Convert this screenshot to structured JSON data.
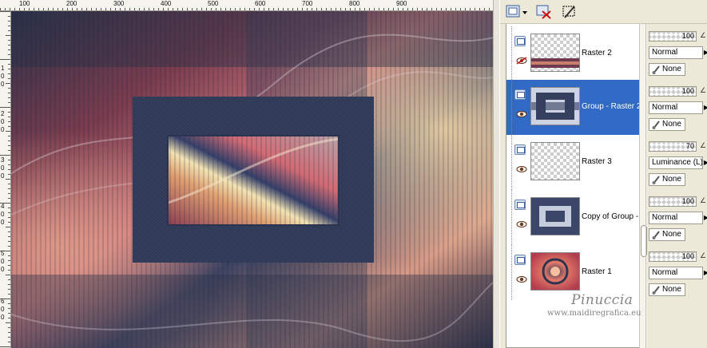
{
  "rulers": {
    "top_labels": [
      "100",
      "200",
      "300",
      "400",
      "500",
      "600",
      "700",
      "800",
      "900"
    ],
    "left_labels": [
      "1",
      "0",
      "0",
      "2",
      "0",
      "0",
      "3",
      "0",
      "0",
      "4",
      "0",
      "0",
      "5",
      "0",
      "0",
      "6",
      "0",
      "0"
    ]
  },
  "toolbar": {
    "new_layer_icon": "new-layer-icon",
    "delete_icon": "delete-layer-icon",
    "mask_icon": "mask-icon"
  },
  "layers": [
    {
      "name": "Raster 2",
      "selected": false,
      "visible": false,
      "thumb": "checker-strip"
    },
    {
      "name": "Group - Raster 2",
      "selected": true,
      "visible": true,
      "thumb": "frame"
    },
    {
      "name": "Raster 3",
      "selected": false,
      "visible": true,
      "thumb": "checker"
    },
    {
      "name": "Copy of Group -",
      "selected": false,
      "visible": true,
      "thumb": "tiles"
    },
    {
      "name": "Raster 1",
      "selected": false,
      "visible": true,
      "thumb": "swirl"
    }
  ],
  "properties": [
    {
      "opacity": "100",
      "blend": "Normal",
      "mask": "None"
    },
    {
      "opacity": "100",
      "blend": "Normal",
      "mask": "None"
    },
    {
      "opacity": "70",
      "blend": "Luminance (L)",
      "mask": "None"
    },
    {
      "opacity": "100",
      "blend": "Normal",
      "mask": "None"
    },
    {
      "opacity": "100",
      "blend": "Normal",
      "mask": "None"
    }
  ],
  "watermark": {
    "title": "Pinuccia",
    "url": "www.maidiregrafica.eu"
  },
  "colors": {
    "selection": "#316ac5",
    "canvas_frame": "#34405e",
    "panel_bg": "#ece9d8"
  }
}
